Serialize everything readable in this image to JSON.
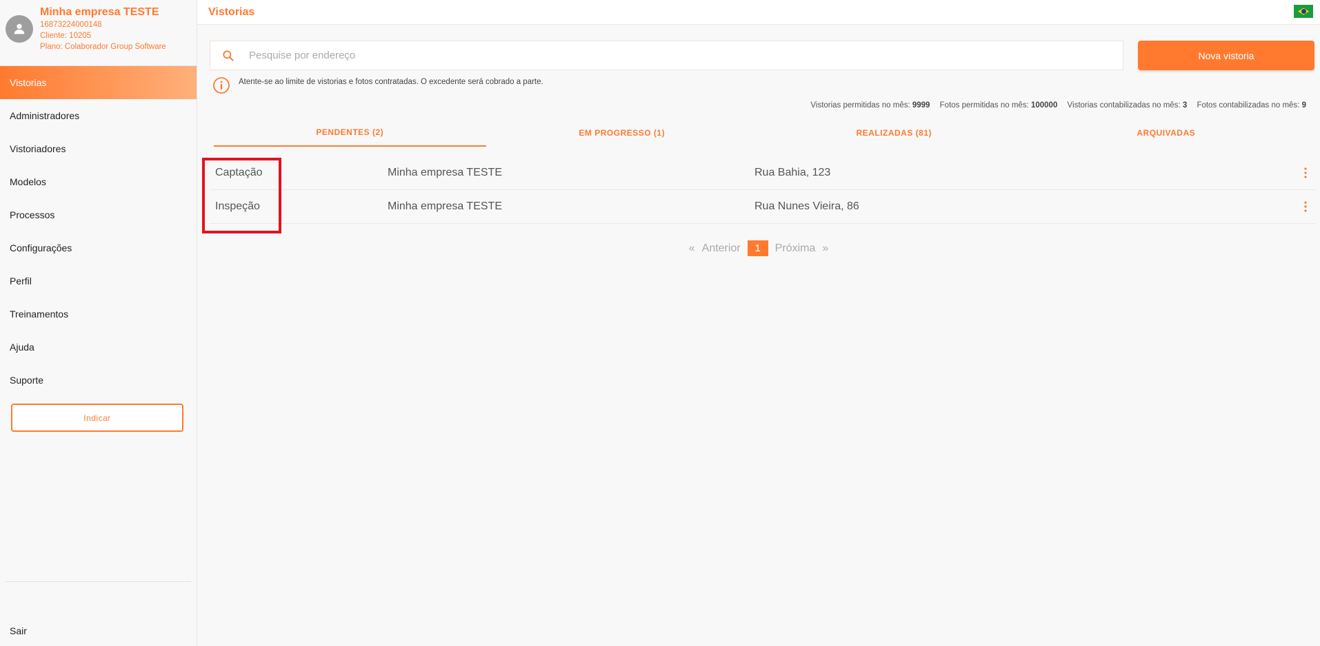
{
  "profile": {
    "company": "Minha empresa TESTE",
    "cnpj": "16873224000148",
    "client": "Cliente: 10205",
    "plan": "Plano: Colaborador Group Software"
  },
  "sidebar": {
    "items": [
      {
        "label": "Vistorias",
        "active": true
      },
      {
        "label": "Administradores"
      },
      {
        "label": "Vistoriadores"
      },
      {
        "label": "Modelos"
      },
      {
        "label": "Processos"
      },
      {
        "label": "Configurações"
      },
      {
        "label": "Perfil"
      },
      {
        "label": "Treinamentos"
      },
      {
        "label": "Ajuda"
      },
      {
        "label": "Suporte"
      }
    ],
    "indicar_label": "Indicar",
    "logout_label": "Sair"
  },
  "header": {
    "title": "Vistorias",
    "flag_icon": "brazil-flag-icon"
  },
  "search": {
    "placeholder": "Pesquise por endereço",
    "value": ""
  },
  "new_button_label": "Nova vistoria",
  "info_text": "Atente-se ao limite de vistorias e fotos contratadas. O excedente será cobrado a parte.",
  "stats": [
    {
      "label": "Vistorias permitidas no mês:",
      "value": "9999"
    },
    {
      "label": "Fotos permitidas no mês:",
      "value": "100000"
    },
    {
      "label": "Vistorias contabilizadas no mês:",
      "value": "3"
    },
    {
      "label": "Fotos contabilizadas no mês:",
      "value": "9"
    }
  ],
  "tabs": [
    {
      "label": "PENDENTES (2)",
      "active": true
    },
    {
      "label": "EM PROGRESSO (1)"
    },
    {
      "label": "REALIZADAS (81)"
    },
    {
      "label": "ARQUIVADAS"
    }
  ],
  "rows": [
    {
      "type": "Captação",
      "company": "Minha empresa TESTE",
      "address": "Rua Bahia, 123"
    },
    {
      "type": "Inspeção",
      "company": "Minha empresa TESTE",
      "address": "Rua Nunes Vieira, 86"
    }
  ],
  "pagination": {
    "prev_symbol": "«",
    "prev_label": "Anterior",
    "current": "1",
    "next_label": "Próxima",
    "next_symbol": "»"
  },
  "colors": {
    "accent": "#ff7a2f",
    "highlight": "#e3131f"
  }
}
